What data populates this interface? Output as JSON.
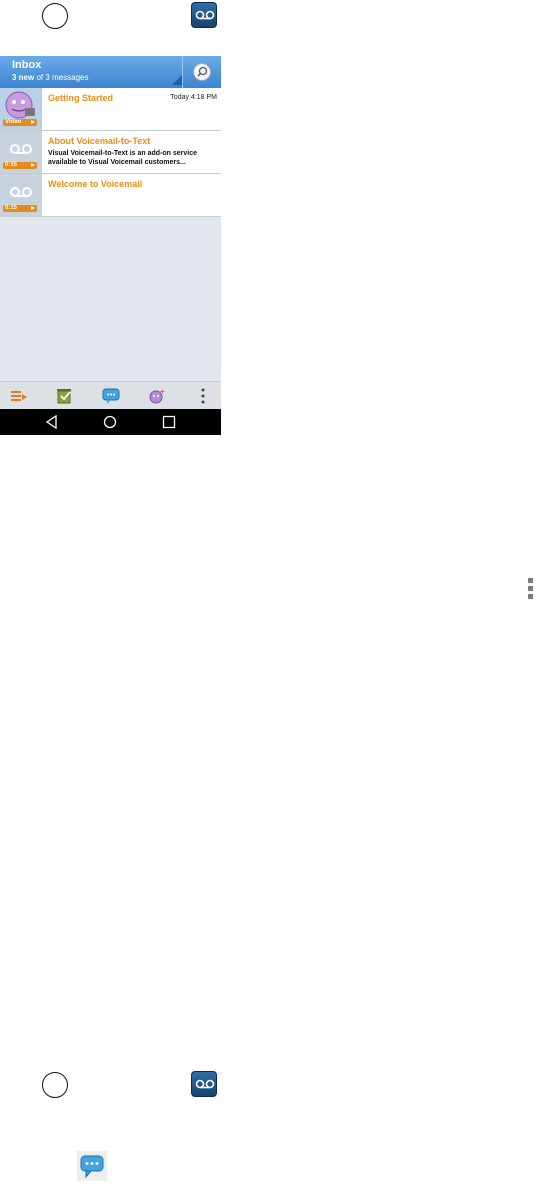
{
  "top_icons": {
    "home": "home-button-icon",
    "voicemail": "voicemail-app-icon"
  },
  "inbox": {
    "title": "Inbox",
    "new_count": "3 new",
    "of_total": " of 3 messages"
  },
  "messages": [
    {
      "title": "Getting Started",
      "time": "Today 4:18 PM",
      "body": "",
      "badge": "Video"
    },
    {
      "title": "About Voicemail-to-Text",
      "time": "",
      "body": "Visual Voicemail-to-Text is an add-on service available to Visual Voicemail customers...",
      "badge": "0:15"
    },
    {
      "title": "Welcome to Voicemail",
      "time": "",
      "body": "",
      "badge": "0:15"
    }
  ],
  "toolbar": [
    "play-all-icon",
    "delete-icon",
    "compose-message-icon",
    "add-contact-icon",
    "more-options-icon"
  ],
  "colors": {
    "accent_orange": "#f28c12",
    "header_blue": "#4a90d9",
    "voicemail_icon": "#1f4f80"
  }
}
